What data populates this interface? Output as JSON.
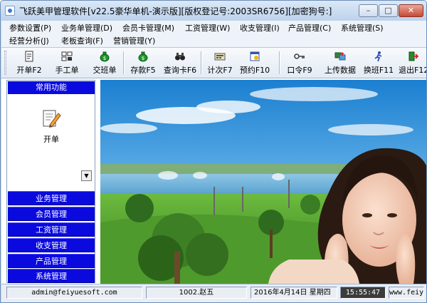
{
  "window": {
    "title": "飞跃美甲管理软件[v22.5豪华单机-演示版][版权登记号:2003SR6756][加密狗号:]",
    "min_label": "–",
    "max_label": "□",
    "close_label": "✕"
  },
  "menu": {
    "items": [
      {
        "label": "参数设置(P)"
      },
      {
        "label": "业务单管理(D)"
      },
      {
        "label": "会员卡管理(M)"
      },
      {
        "label": "工资管理(W)"
      },
      {
        "label": "收支管理(I)"
      },
      {
        "label": "产品管理(C)"
      },
      {
        "label": "系统管理(S)"
      },
      {
        "label": "经营分析(J)"
      },
      {
        "label": "老板查询(F)"
      },
      {
        "label": "营销管理(Y)"
      }
    ]
  },
  "toolbar": {
    "buttons": [
      {
        "label": "开单F2",
        "icon": "document-icon"
      },
      {
        "label": "手工单",
        "icon": "grid-icon"
      },
      {
        "label": "交班单",
        "icon": "money-bag-icon"
      },
      {
        "label": "存款F5",
        "icon": "money-bag-icon"
      },
      {
        "label": "查询卡F6",
        "icon": "binoculars-icon"
      },
      {
        "label": "计次F7",
        "icon": "counter-icon"
      },
      {
        "label": "预约F10",
        "icon": "calendar-icon"
      },
      {
        "label": "口令F9",
        "icon": "key-icon"
      },
      {
        "label": "上传数据",
        "icon": "upload-icon"
      },
      {
        "label": "换班F11",
        "icon": "person-run-icon"
      },
      {
        "label": "退出F12",
        "icon": "exit-icon"
      }
    ]
  },
  "sidebar": {
    "header": "常用功能",
    "open_label": "开单",
    "scroll_arrow": "▼",
    "groups": [
      {
        "label": "业务管理"
      },
      {
        "label": "会员管理"
      },
      {
        "label": "工资管理"
      },
      {
        "label": "收支管理"
      },
      {
        "label": "产品管理"
      },
      {
        "label": "系统管理"
      }
    ]
  },
  "status": {
    "email": "admin@feiyuesoft.com",
    "user": "1002.赵五",
    "date": "2016年4月14日 星期四",
    "time": "15:55:47",
    "site": "www.feiy"
  }
}
